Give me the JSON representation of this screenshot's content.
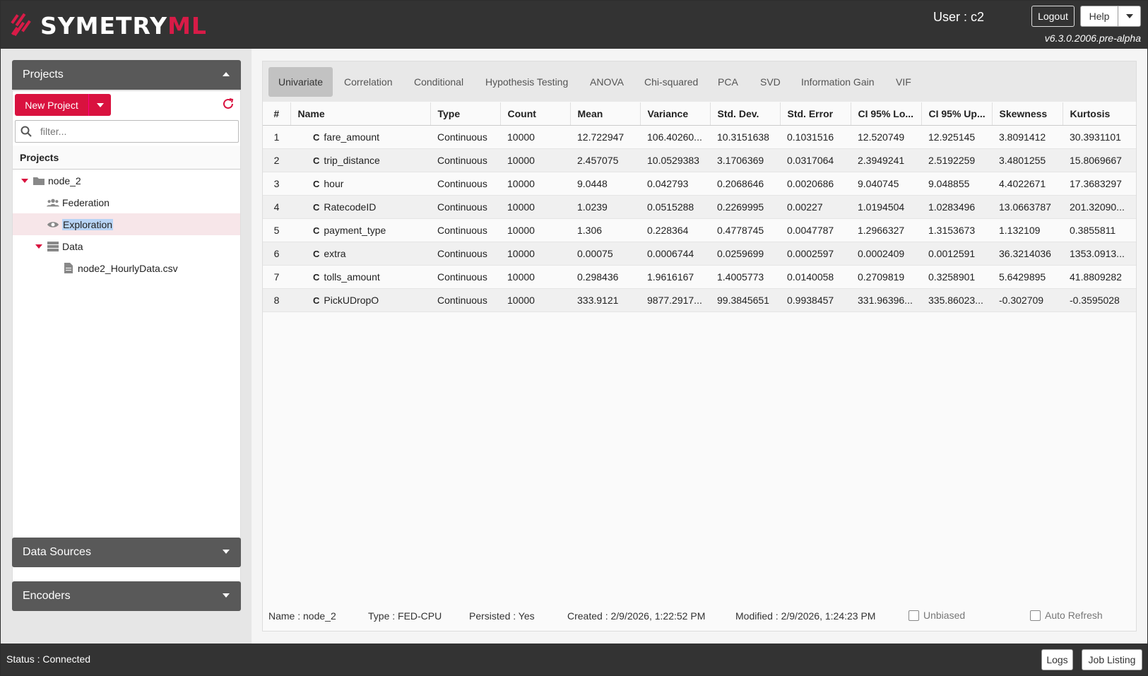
{
  "header": {
    "logo_main": "SYMETRY",
    "logo_accent": "ML",
    "user_label": "User : c2",
    "logout_label": "Logout",
    "help_label": "Help",
    "version": "v6.3.0.2006.pre-alpha"
  },
  "sidebar": {
    "projects_header": "Projects",
    "new_project_label": "New Project",
    "filter_placeholder": "filter...",
    "tree_title": "Projects",
    "tree": [
      {
        "label": "node_2",
        "icon": "folder-open-icon"
      },
      {
        "label": "Federation",
        "icon": "users-icon"
      },
      {
        "label": "Exploration",
        "icon": "eye-icon"
      },
      {
        "label": "Data",
        "icon": "database-icon"
      },
      {
        "label": "node2_HourlyData.csv",
        "icon": "file-icon"
      }
    ],
    "data_sources_header": "Data Sources",
    "encoders_header": "Encoders"
  },
  "tabs": [
    "Univariate",
    "Correlation",
    "Conditional",
    "Hypothesis Testing",
    "ANOVA",
    "Chi-squared",
    "PCA",
    "SVD",
    "Information Gain",
    "VIF"
  ],
  "table": {
    "columns": [
      "#",
      "Name",
      "Type",
      "Count",
      "Mean",
      "Variance",
      "Std. Dev.",
      "Std. Error",
      "CI 95% Lo...",
      "CI 95% Up...",
      "Skewness",
      "Kurtosis"
    ],
    "rows": [
      [
        "1",
        "fare_amount",
        "Continuous",
        "10000",
        "12.722947",
        "106.40260...",
        "10.3151638",
        "0.1031516",
        "12.520749",
        "12.925145",
        "3.8091412",
        "30.3931101"
      ],
      [
        "2",
        "trip_distance",
        "Continuous",
        "10000",
        "2.457075",
        "10.0529383",
        "3.1706369",
        "0.0317064",
        "2.3949241",
        "2.5192259",
        "3.4801255",
        "15.8069667"
      ],
      [
        "3",
        "hour",
        "Continuous",
        "10000",
        "9.0448",
        "0.042793",
        "0.2068646",
        "0.0020686",
        "9.040745",
        "9.048855",
        "4.4022671",
        "17.3683297"
      ],
      [
        "4",
        "RatecodeID",
        "Continuous",
        "10000",
        "1.0239",
        "0.0515288",
        "0.2269995",
        "0.00227",
        "1.0194504",
        "1.0283496",
        "13.0663787",
        "201.32090..."
      ],
      [
        "5",
        "payment_type",
        "Continuous",
        "10000",
        "1.306",
        "0.228364",
        "0.4778745",
        "0.0047787",
        "1.2966327",
        "1.3153673",
        "1.132109",
        "0.3855811"
      ],
      [
        "6",
        "extra",
        "Continuous",
        "10000",
        "0.00075",
        "0.0006744",
        "0.0259699",
        "0.0002597",
        "0.0002409",
        "0.0012591",
        "36.3214036",
        "1353.0913..."
      ],
      [
        "7",
        "tolls_amount",
        "Continuous",
        "10000",
        "0.298436",
        "1.9616167",
        "1.4005773",
        "0.0140058",
        "0.2709819",
        "0.3258901",
        "5.6429895",
        "41.8809282"
      ],
      [
        "8",
        "PickUDropO",
        "Continuous",
        "10000",
        "333.9121",
        "9877.2917...",
        "99.3845651",
        "0.9938457",
        "331.96396...",
        "335.86023...",
        "-0.302709",
        "-0.3595028"
      ]
    ],
    "type_badge": "C"
  },
  "footer": {
    "name": "Name : node_2",
    "type": "Type : FED-CPU",
    "persisted": "Persisted : Yes",
    "created": "Created : 2/9/2026, 1:22:52 PM",
    "modified": "Modified : 2/9/2026, 1:24:23 PM",
    "unbiased": "Unbiased",
    "auto_refresh": "Auto Refresh"
  },
  "statusbar": {
    "status": "Status : Connected",
    "logs_label": "Logs",
    "job_listing_label": "Job Listing"
  },
  "colors": {
    "accent": "#d9123f",
    "header_bg": "#333333"
  }
}
